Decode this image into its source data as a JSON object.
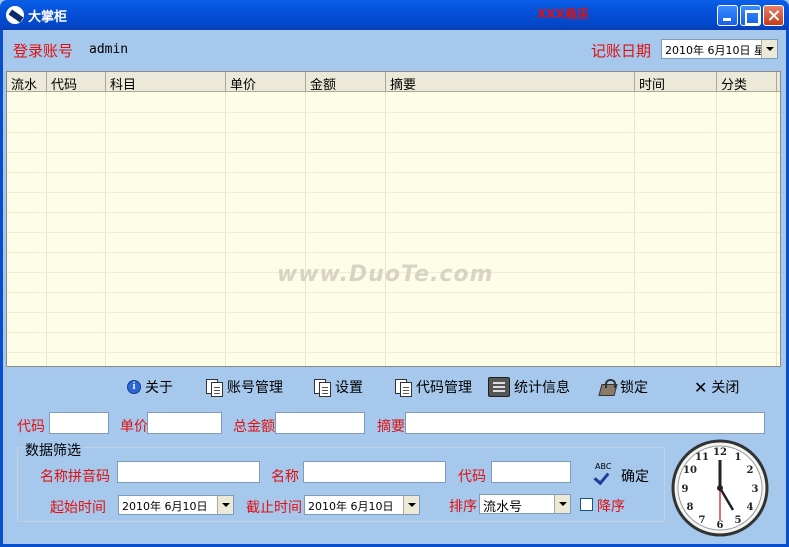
{
  "window": {
    "title": "大掌柜",
    "center_tag": "XXX商店",
    "title_color": "#0a4ed0"
  },
  "header": {
    "account_label": "登录账号",
    "account_value": "admin",
    "date_label": "记账日期",
    "date_value": "2010年  6月10日 星"
  },
  "table": {
    "columns": [
      "流水",
      "代码",
      "科目",
      "单价",
      "金额",
      "摘要",
      "时间",
      "分类"
    ],
    "rows": [],
    "watermark": "www.DuoTe.com"
  },
  "toolbar": {
    "buttons": [
      {
        "label": "关于",
        "icon": "info-icon"
      },
      {
        "label": "账号管理",
        "icon": "document-icon"
      },
      {
        "label": "设置",
        "icon": "document-icon"
      },
      {
        "label": "代码管理",
        "icon": "document-icon"
      },
      {
        "label": "统计信息",
        "icon": "stats-icon"
      },
      {
        "label": "锁定",
        "icon": "lock-icon"
      },
      {
        "label": "关闭",
        "icon": "close-icon"
      }
    ]
  },
  "entry": {
    "code_label": "代码",
    "price_label": "单价",
    "total_label": "总金额",
    "summary_label": "摘要"
  },
  "filter": {
    "title": "数据筛选",
    "pinyin_label": "名称拼音码",
    "name_label": "名称",
    "code_label": "代码",
    "confirm_label": "确定",
    "abc_text": "ABC",
    "start_label": "起始时间",
    "start_value": "2010年  6月10日",
    "end_label": "截止时间",
    "end_value": "2010年  6月10日",
    "sort_label": "排序",
    "sort_value": "流水号",
    "desc_label": "降序"
  },
  "colors": {
    "label_red": "#e01010",
    "background": "#a6c8ec",
    "table_bg": "#fefde8"
  }
}
